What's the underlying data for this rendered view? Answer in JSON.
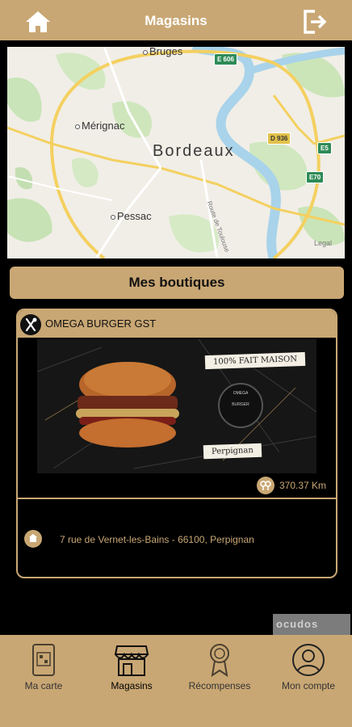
{
  "header": {
    "title": "Magasins"
  },
  "map": {
    "cities": {
      "bruges": "Bruges",
      "merignac": "Mérignac",
      "bordeaux": "Bordeaux",
      "pessac": "Pessac"
    },
    "shields": [
      "E 606",
      "D 936",
      "E5",
      "E70"
    ],
    "road_label": "Route de Toulouse",
    "credit": "Legal"
  },
  "section_button": "Mes boutiques",
  "store": {
    "name": "OMEGA BURGER GST",
    "image_texts": {
      "pill_top": "100% FAIT MAISON",
      "badge_line1": "OMEGA",
      "badge_line2": "BURGER",
      "pill_bottom": "Perpignan"
    },
    "distance": "370.37 Km",
    "address": "7 rue de Vernet-les-Bains - 66100, Perpignan"
  },
  "watermark": "ocudos",
  "tabs": [
    {
      "label": "Ma carte"
    },
    {
      "label": "Magasins"
    },
    {
      "label": "Récompenses"
    },
    {
      "label": "Mon compte"
    }
  ],
  "colors": {
    "accent": "#c9a774",
    "background": "#000000"
  }
}
